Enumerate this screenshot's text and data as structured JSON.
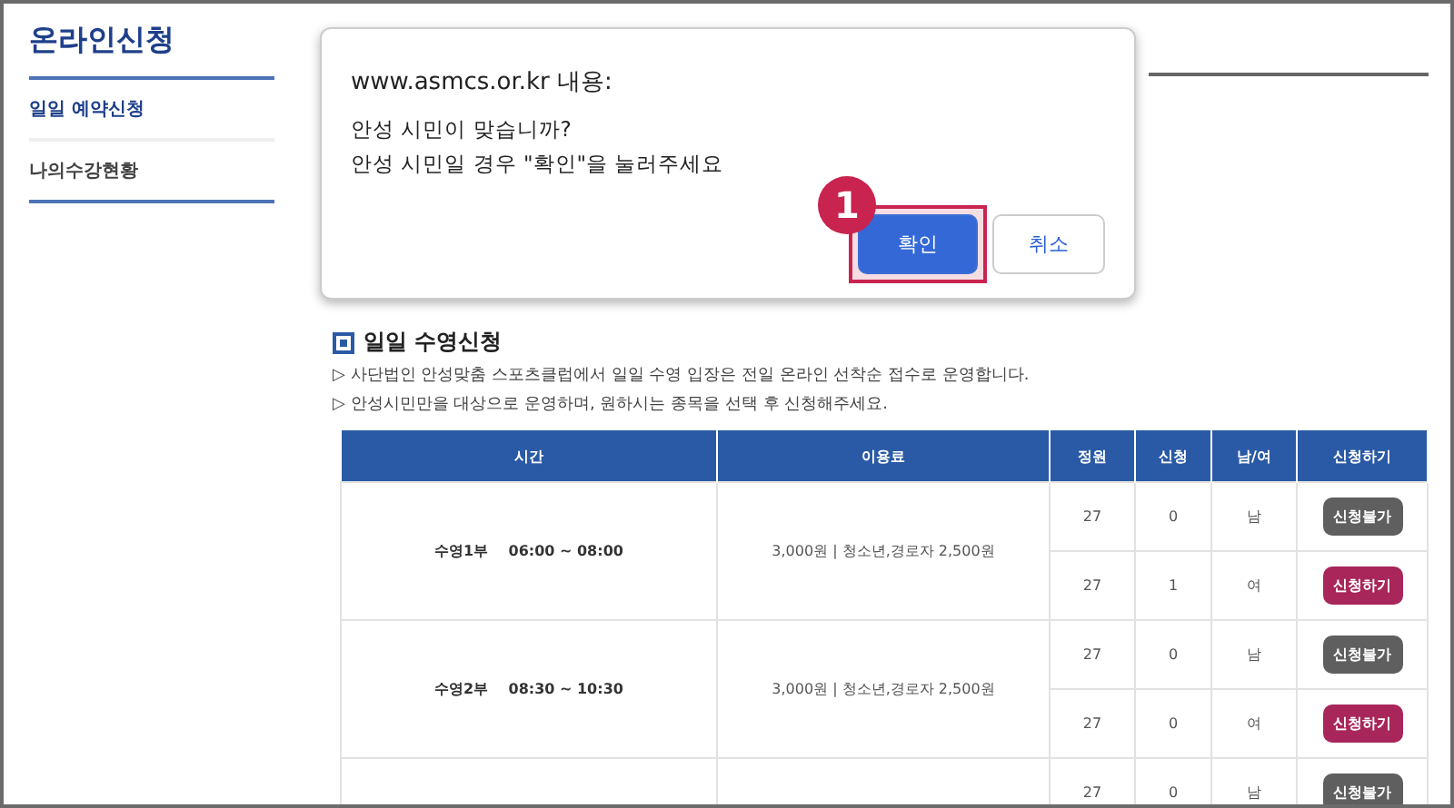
{
  "sidebar": {
    "title": "온라인신청",
    "items": [
      {
        "label": "일일 예약신청",
        "selected": true
      },
      {
        "label": "나의수강현황",
        "selected": false
      }
    ]
  },
  "section": {
    "title": "일일 수영신청",
    "notes": [
      "▷ 사단법인 안성맞춤 스포츠클럽에서 일일 수영 입장은 전일 온라인 선착순 접수로 운영합니다.",
      "▷ 안성시민만을 대상으로 운영하며, 원하시는 종목을 선택 후 신청해주세요."
    ]
  },
  "table": {
    "columns": [
      "시간",
      "이용료",
      "정원",
      "신청",
      "남/여",
      "신청하기"
    ],
    "groups": [
      {
        "session": "수영1부",
        "time": "06:00 ~ 08:00",
        "fee": "3,000원 | 청소년,경로자 2,500원",
        "slots": [
          {
            "capacity": "27",
            "applied": "0",
            "gender": "남",
            "action": {
              "label": "신청불가",
              "kind": "closed"
            }
          },
          {
            "capacity": "27",
            "applied": "1",
            "gender": "여",
            "action": {
              "label": "신청하기",
              "kind": "open"
            }
          }
        ]
      },
      {
        "session": "수영2부",
        "time": "08:30 ~ 10:30",
        "fee": "3,000원 | 청소년,경로자 2,500원",
        "slots": [
          {
            "capacity": "27",
            "applied": "0",
            "gender": "남",
            "action": {
              "label": "신청불가",
              "kind": "closed"
            }
          },
          {
            "capacity": "27",
            "applied": "0",
            "gender": "여",
            "action": {
              "label": "신청하기",
              "kind": "open"
            }
          }
        ]
      },
      {
        "slots": [
          {
            "capacity": "27",
            "applied": "0",
            "gender": "남",
            "action": {
              "label": "신청불가",
              "kind": "closed"
            }
          }
        ]
      }
    ]
  },
  "dialog": {
    "title": "www.asmcs.or.kr 내용:",
    "lines": [
      "안성 시민이 맞습니까?",
      "안성 시민일 경우 \"확인\"을 눌러주세요"
    ],
    "buttons": [
      {
        "label": "확인",
        "kind": "primary",
        "highlighted": true
      },
      {
        "label": "취소",
        "kind": "secondary",
        "highlighted": false
      }
    ],
    "step_badge": "1"
  }
}
